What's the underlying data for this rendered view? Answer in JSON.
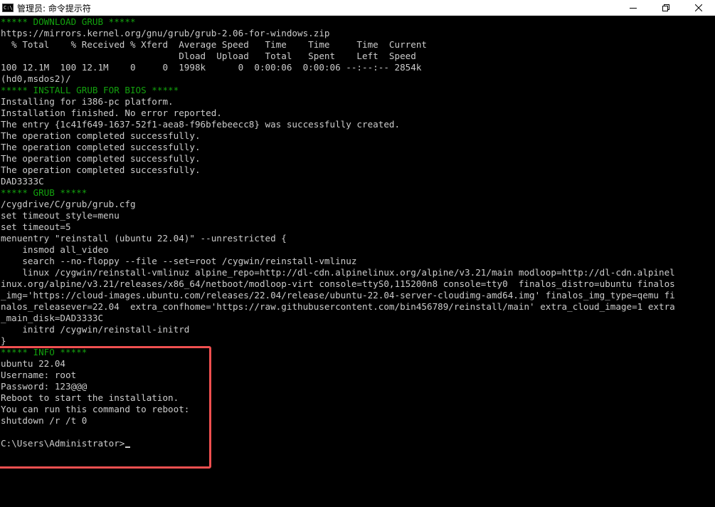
{
  "window": {
    "title": "管理员: 命令提示符",
    "icon": "cmd-icon"
  },
  "colors": {
    "background": "#000000",
    "text": "#cccccc",
    "heading": "#13a10e",
    "highlight": "#f05050"
  },
  "console": {
    "lines": [
      "***** DOWNLOAD GRUB *****",
      "https://mirrors.kernel.org/gnu/grub/grub-2.06-for-windows.zip",
      "  % Total    % Received % Xferd  Average Speed   Time    Time     Time  Current",
      "                                 Dload  Upload   Total   Spent    Left  Speed",
      "100 12.1M  100 12.1M    0     0  1998k      0  0:00:06  0:00:06 --:--:-- 2854k",
      "(hd0,msdos2)/",
      "***** INSTALL GRUB FOR BIOS *****",
      "Installing for i386-pc platform.",
      "Installation finished. No error reported.",
      "The entry {1c41f649-1637-52f1-aea8-f96bfebeecc8} was successfully created.",
      "The operation completed successfully.",
      "The operation completed successfully.",
      "The operation completed successfully.",
      "The operation completed successfully.",
      "DAD3333C",
      "***** GRUB *****",
      "/cygdrive/C/grub/grub.cfg",
      "set timeout_style=menu",
      "set timeout=5",
      "menuentry \"reinstall (ubuntu 22.04)\" --unrestricted {",
      "    insmod all_video",
      "    search --no-floppy --file --set=root /cygwin/reinstall-vmlinuz",
      "    linux /cygwin/reinstall-vmlinuz alpine_repo=http://dl-cdn.alpinelinux.org/alpine/v3.21/main modloop=http://dl-cdn.alpinel",
      "inux.org/alpine/v3.21/releases/x86_64/netboot/modloop-virt console=ttyS0,115200n8 console=tty0  finalos_distro=ubuntu finalos",
      "_img='https://cloud-images.ubuntu.com/releases/22.04/release/ubuntu-22.04-server-cloudimg-amd64.img' finalos_img_type=qemu fi",
      "nalos_releasever=22.04  extra_confhome='https://raw.githubusercontent.com/bin456789/reinstall/main' extra_cloud_image=1 extra",
      "_main_disk=DAD3333C",
      "    initrd /cygwin/reinstall-initrd",
      "}",
      "***** INFO *****",
      "ubuntu 22.04",
      "Username: root",
      "Password: 123@@@",
      "Reboot to start the installation.",
      "You can run this command to reboot:",
      "shutdown /r /t 0",
      "",
      "C:\\Users\\Administrator>"
    ]
  }
}
